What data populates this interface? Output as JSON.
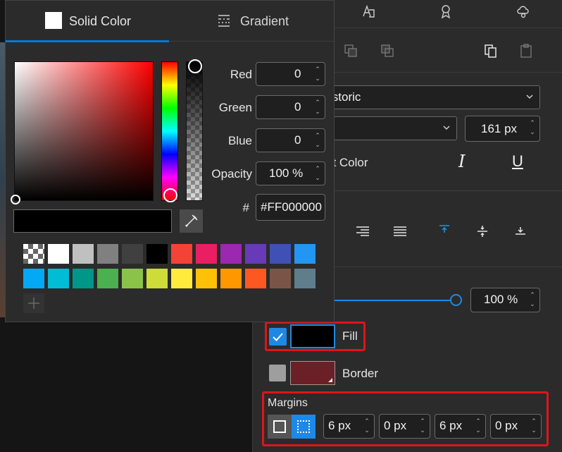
{
  "color_picker": {
    "tabs": [
      {
        "label": "Solid Color",
        "active": true
      },
      {
        "label": "Gradient",
        "active": false
      }
    ],
    "fields": {
      "red": {
        "label": "Red",
        "value": "0"
      },
      "green": {
        "label": "Green",
        "value": "0"
      },
      "blue": {
        "label": "Blue",
        "value": "0"
      },
      "opacity": {
        "label": "Opacity",
        "value": "100 %"
      },
      "hex": {
        "label": "#",
        "value": "#FF000000"
      }
    },
    "preview_color": "#000000",
    "swatches_row1": [
      "transparent-checker",
      "#FFFFFF",
      "#C0C0C0",
      "#808080",
      "#404040",
      "#000000",
      "#F44336",
      "#E91E63",
      "#9C27B0",
      "#673AB7",
      "#3F51B5",
      "#2196F3"
    ],
    "swatches_row2": [
      "#03A9F4",
      "#00BCD4",
      "#009688",
      "#4CAF50",
      "#8BC34A",
      "#CDDC39",
      "#FFEB3B",
      "#FFC107",
      "#FF9800",
      "#FF5722",
      "#795548",
      "#607D8B"
    ],
    "add_swatch_icon": "plus-icon"
  },
  "right_panel": {
    "font_family": "istoric",
    "font_style": "",
    "font_size": "161 px",
    "font_color_label": "nt Color",
    "opacity_value": "100 %",
    "fill": {
      "label": "Fill",
      "checked": true,
      "color": "#000000"
    },
    "border": {
      "label": "Border",
      "checked": false,
      "color": "#6B1F26"
    },
    "margins": {
      "label": "Margins",
      "values": [
        "6 px",
        "0 px",
        "6 px",
        "0 px"
      ]
    }
  },
  "colors": {
    "accent": "#0078D7",
    "highlight": "#E0141B",
    "panel_bg": "#2B2B2B"
  }
}
